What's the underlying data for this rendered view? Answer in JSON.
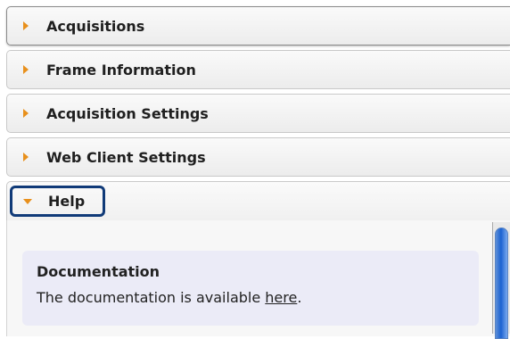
{
  "accordion": {
    "sections": [
      {
        "label": "Acquisitions"
      },
      {
        "label": "Frame Information"
      },
      {
        "label": "Acquisition Settings"
      },
      {
        "label": "Web Client Settings"
      }
    ],
    "help": {
      "label": "Help",
      "documentation_title": "Documentation",
      "documentation_text": "The documentation is available ",
      "documentation_link": "here",
      "documentation_end": "."
    }
  },
  "colors": {
    "arrow": "#e8901c",
    "focus_ring": "#103a78",
    "doc_box_bg": "#ebebf7",
    "scroll_thumb": "#1b62d1"
  },
  "icons": {
    "collapsed": "triangle-right-icon",
    "expanded": "triangle-down-icon"
  }
}
